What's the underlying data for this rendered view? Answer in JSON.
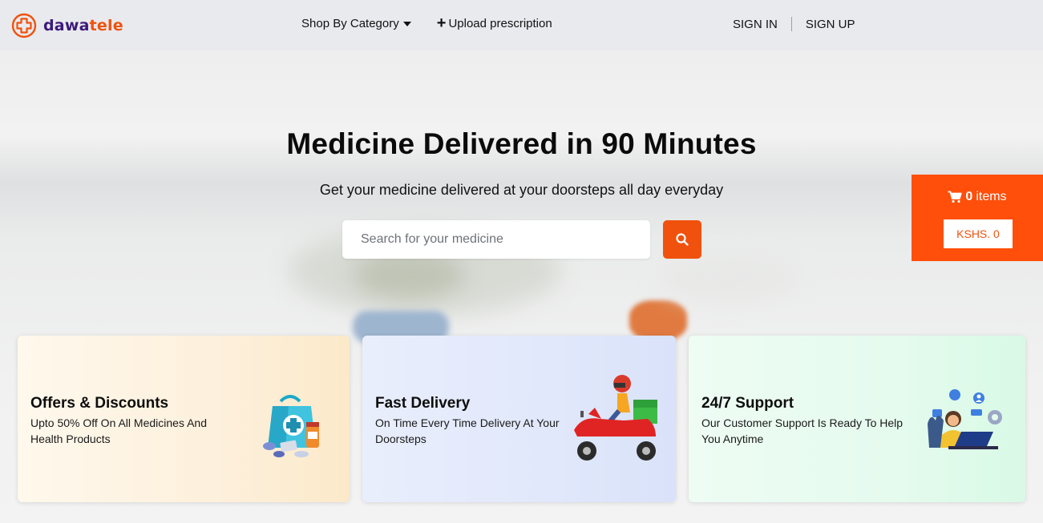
{
  "brand": {
    "name_part1": "dawa",
    "name_part2": "tele",
    "logo_icon": "medical-cross-icon",
    "color_primary": "#3c1a7a",
    "color_accent": "#f0520d"
  },
  "nav": {
    "shop_by_category": "Shop By Category",
    "upload_prescription": "Upload prescription",
    "sign_in": "SIGN IN",
    "sign_up": "SIGN UP"
  },
  "hero": {
    "title": "Medicine Delivered in 90 Minutes",
    "subtitle": "Get your medicine delivered at your doorsteps all day everyday",
    "search_placeholder": "Search for your medicine",
    "search_icon": "search-icon"
  },
  "cart": {
    "count": "0",
    "items_label": "items",
    "price": "KSHS. 0",
    "icon": "cart-icon",
    "color": "#ff4f0a"
  },
  "features": [
    {
      "title": "Offers & Discounts",
      "description": "Upto 50% Off On All Medicines And Health Products",
      "icon": "medicine-bag-icon"
    },
    {
      "title": "Fast Delivery",
      "description": "On Time Every Time Delivery At Your Doorsteps",
      "icon": "delivery-scooter-icon"
    },
    {
      "title": "24/7 Support",
      "description": "Our Customer Support Is Ready To Help You Anytime",
      "icon": "customer-support-icon"
    }
  ]
}
